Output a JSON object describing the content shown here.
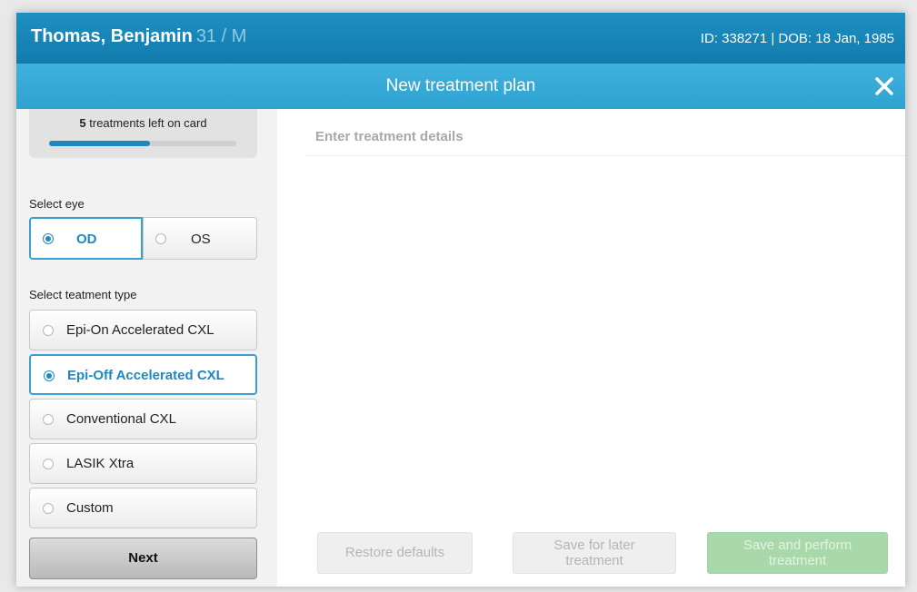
{
  "patient": {
    "name": "Thomas, Benjamin",
    "age_sex": "31 / M",
    "meta": "ID: 338271 | DOB: 18 Jan, 1985"
  },
  "dialog": {
    "title": "New treatment plan",
    "close_icon": "close-icon"
  },
  "card": {
    "count": "5",
    "text": " treatments left on card",
    "progress": 0.54,
    "progress_color": "#1f88c0"
  },
  "eye": {
    "label": "Select eye",
    "options": [
      "OD",
      "OS"
    ],
    "selected": "OD"
  },
  "treatment_type": {
    "label": "Select teatment type",
    "options": [
      "Epi-On Accelerated CXL",
      "Epi-Off Accelerated CXL",
      "Conventional CXL",
      "LASIK Xtra",
      "Custom"
    ],
    "selected": "Epi-Off Accelerated CXL"
  },
  "next_label": "Next",
  "main": {
    "section_title": "Enter treatment details"
  },
  "footer": {
    "restore_label": "Restore defaults",
    "save_later_line1": "Save for later",
    "save_later_line2": "treatment",
    "save_perform_line1": "Save and perform",
    "save_perform_line2": "treatment"
  },
  "colors": {
    "accent": "#1f88c0",
    "header": "#127bad",
    "titlebar": "#2ea2d2",
    "perform_button": "#a9d9ab"
  }
}
